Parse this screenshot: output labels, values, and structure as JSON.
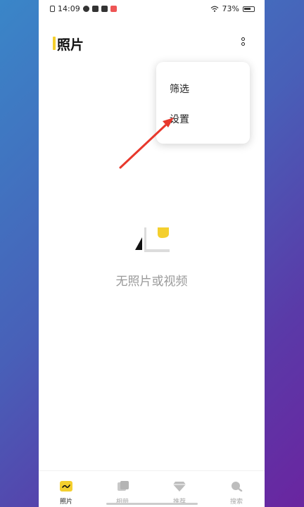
{
  "status": {
    "time": "14:09",
    "battery": "73%"
  },
  "header": {
    "title": "照片"
  },
  "menu": {
    "items": [
      {
        "label": "筛选"
      },
      {
        "label": "设置"
      }
    ]
  },
  "empty": {
    "text": "无照片或视频"
  },
  "tabs": [
    {
      "label": "照片",
      "icon": "photo-tab-icon",
      "active": true
    },
    {
      "label": "相册",
      "icon": "album-icon",
      "active": false
    },
    {
      "label": "推荐",
      "icon": "diamond-icon",
      "active": false
    },
    {
      "label": "搜索",
      "icon": "search-icon",
      "active": false
    }
  ],
  "colors": {
    "accent": "#f4cf2e",
    "arrow": "#e8382c"
  }
}
